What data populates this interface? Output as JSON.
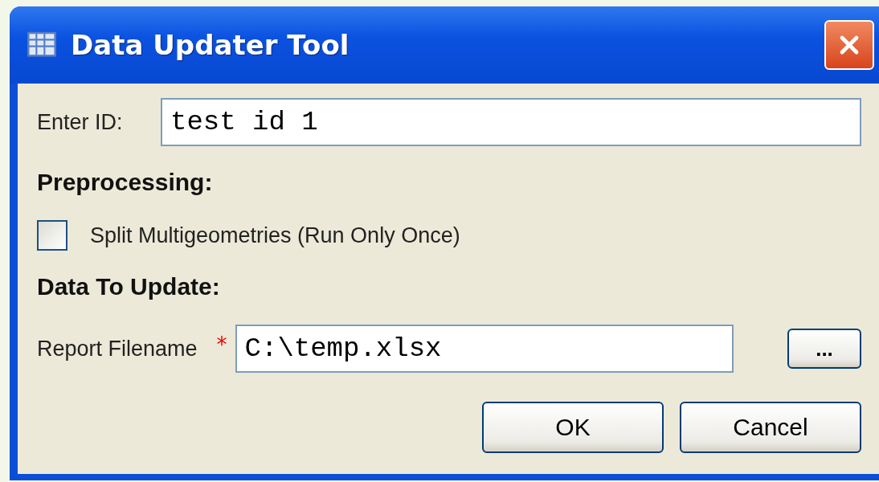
{
  "window": {
    "title": "Data Updater Tool"
  },
  "id_field": {
    "label": "Enter ID:",
    "value": "test id 1"
  },
  "preprocessing": {
    "heading": "Preprocessing:",
    "options": [
      {
        "label": "Split Multigeometries (Run Only Once)",
        "checked": false
      }
    ]
  },
  "data_to_update": {
    "heading": "Data To Update:",
    "label": "Report Filename",
    "required_mark": "*",
    "value": "C:\\temp.xlsx",
    "browse_button": "..."
  },
  "buttons": [
    "OK",
    "Cancel"
  ]
}
